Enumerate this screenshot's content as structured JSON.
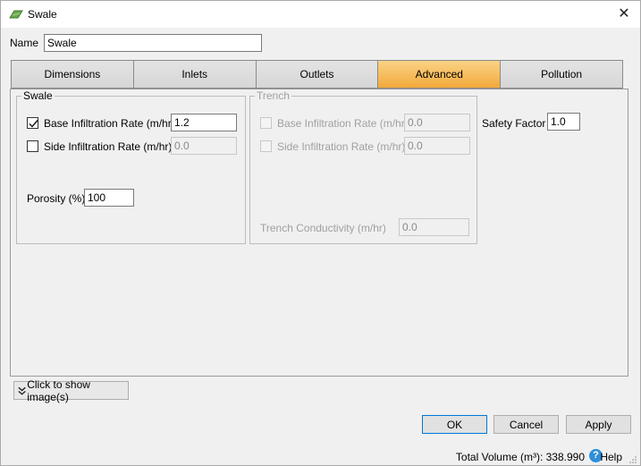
{
  "window": {
    "title": "Swale",
    "close": "✕"
  },
  "name_field": {
    "label": "Name",
    "value": "Swale"
  },
  "tabs": [
    {
      "label": "Dimensions"
    },
    {
      "label": "Inlets"
    },
    {
      "label": "Outlets"
    },
    {
      "label": "Advanced",
      "active": true
    },
    {
      "label": "Pollution"
    }
  ],
  "swale_group": {
    "title": "Swale",
    "base_rate": {
      "label": "Base Infiltration Rate (m/hr)",
      "checked": true,
      "value": "1.2"
    },
    "side_rate": {
      "label": "Side Infiltration Rate (m/hr)",
      "checked": false,
      "value": "0.0"
    },
    "porosity": {
      "label": "Porosity (%)",
      "value": "100"
    }
  },
  "trench_group": {
    "title": "Trench",
    "base_rate": {
      "label": "Base Infiltration Rate (m/hr)",
      "value": "0.0"
    },
    "side_rate": {
      "label": "Side Infiltration Rate (m/hr)",
      "value": "0.0"
    },
    "conductivity": {
      "label": "Trench Conductivity (m/hr)",
      "value": "0.0"
    }
  },
  "safety_factor": {
    "label": "Safety Factor",
    "value": "1.0"
  },
  "show_images": {
    "label": "Click to show image(s)"
  },
  "buttons": {
    "ok": "OK",
    "cancel": "Cancel",
    "apply": "Apply"
  },
  "status": {
    "total_volume": "Total Volume (m³): 338.990",
    "help": "Help"
  },
  "colors": {
    "active_tab": "#f2a93a",
    "help_icon": "#2f8fd8"
  }
}
